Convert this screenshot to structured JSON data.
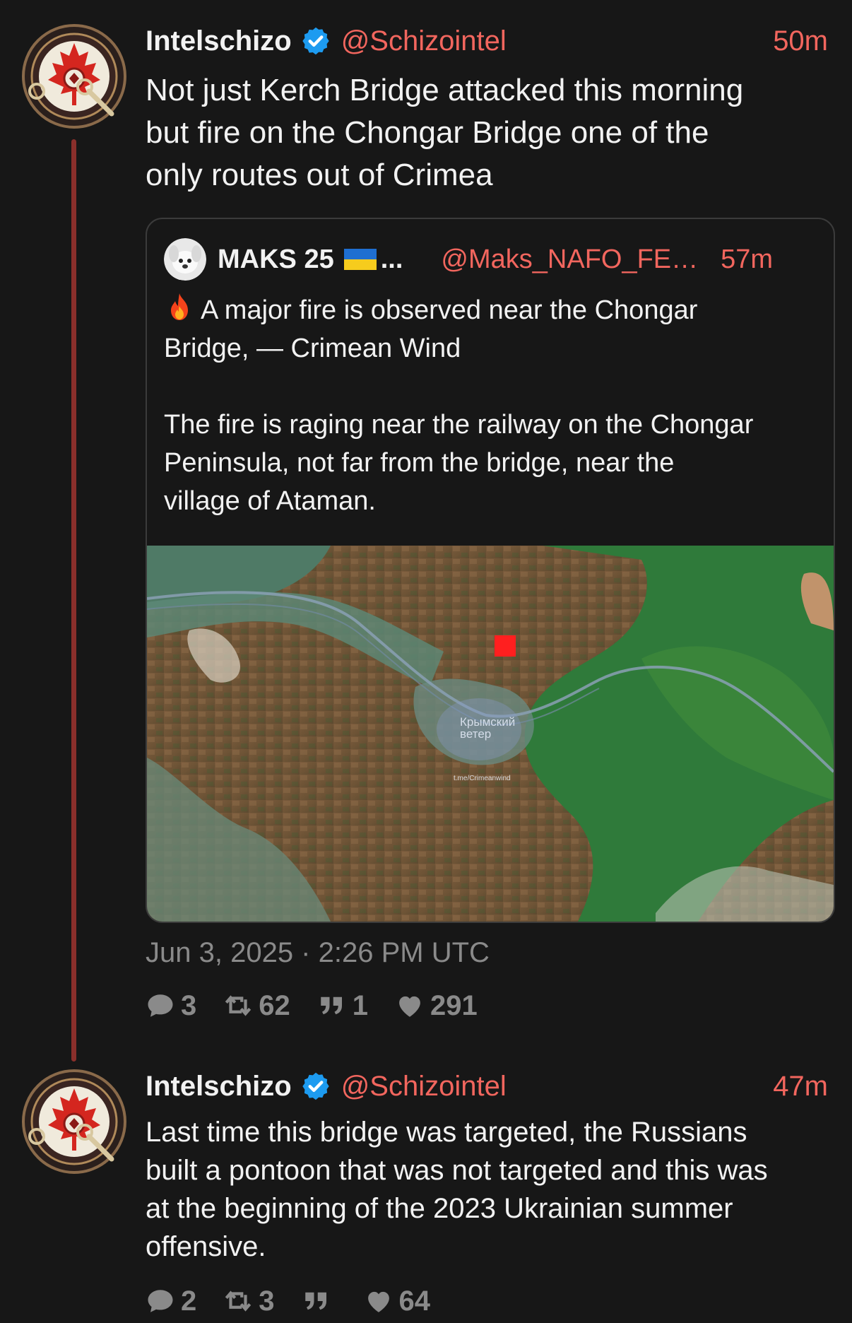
{
  "posts": [
    {
      "author": {
        "name": "Intelschizo",
        "handle": "@Schizointel",
        "verified": true,
        "avatar_icon": "maple-leaf-crest-icon"
      },
      "time": "50m",
      "text": "Not just Kerch Bridge attacked this morning\nbut fire on the Chongar Bridge one of the\nonly routes out of Crimea",
      "quote": {
        "author": {
          "name": "MAKS 25",
          "flag_icon": "ukraine-flag-icon",
          "ellipsis": "...",
          "handle": "@Maks_NAFO_FE…",
          "avatar_icon": "white-dog-avatar-icon"
        },
        "time": "57m",
        "text_line1": "A major fire is observed near the Chongar\nBridge, — Crimean Wind",
        "text_rest": "\nThe fire is raging near the railway on the Chongar\nPeninsula, not far from the bridge, near the\nvillage of Ataman.",
        "fire_icon": "fire-icon",
        "image": {
          "type": "satellite-map",
          "watermark_line1": "Крымский",
          "watermark_line2": "ветер",
          "watermark_url": "t.me/Crimeanwind",
          "marker_color": "#ff1f1f"
        }
      },
      "date": "Jun 3, 2025 · 2:26 PM UTC",
      "stats": {
        "replies": "3",
        "reposts": "62",
        "quotes": "1",
        "likes": "291"
      }
    },
    {
      "author": {
        "name": "Intelschizo",
        "handle": "@Schizointel",
        "verified": true,
        "avatar_icon": "maple-leaf-crest-icon"
      },
      "time": "47m",
      "text": "Last time this bridge was targeted, the Russians\nbuilt a pontoon that was not targeted and this was\nat the beginning of the 2023 Ukrainian summer\noffensive.",
      "stats": {
        "replies": "2",
        "reposts": "3",
        "quotes": "",
        "likes": "64"
      }
    }
  ],
  "colors": {
    "background": "#171717",
    "accent": "#f2665e",
    "muted": "#8a8a8a",
    "thread_line": "#8a2f2b",
    "verified": "#1d9bf0"
  }
}
